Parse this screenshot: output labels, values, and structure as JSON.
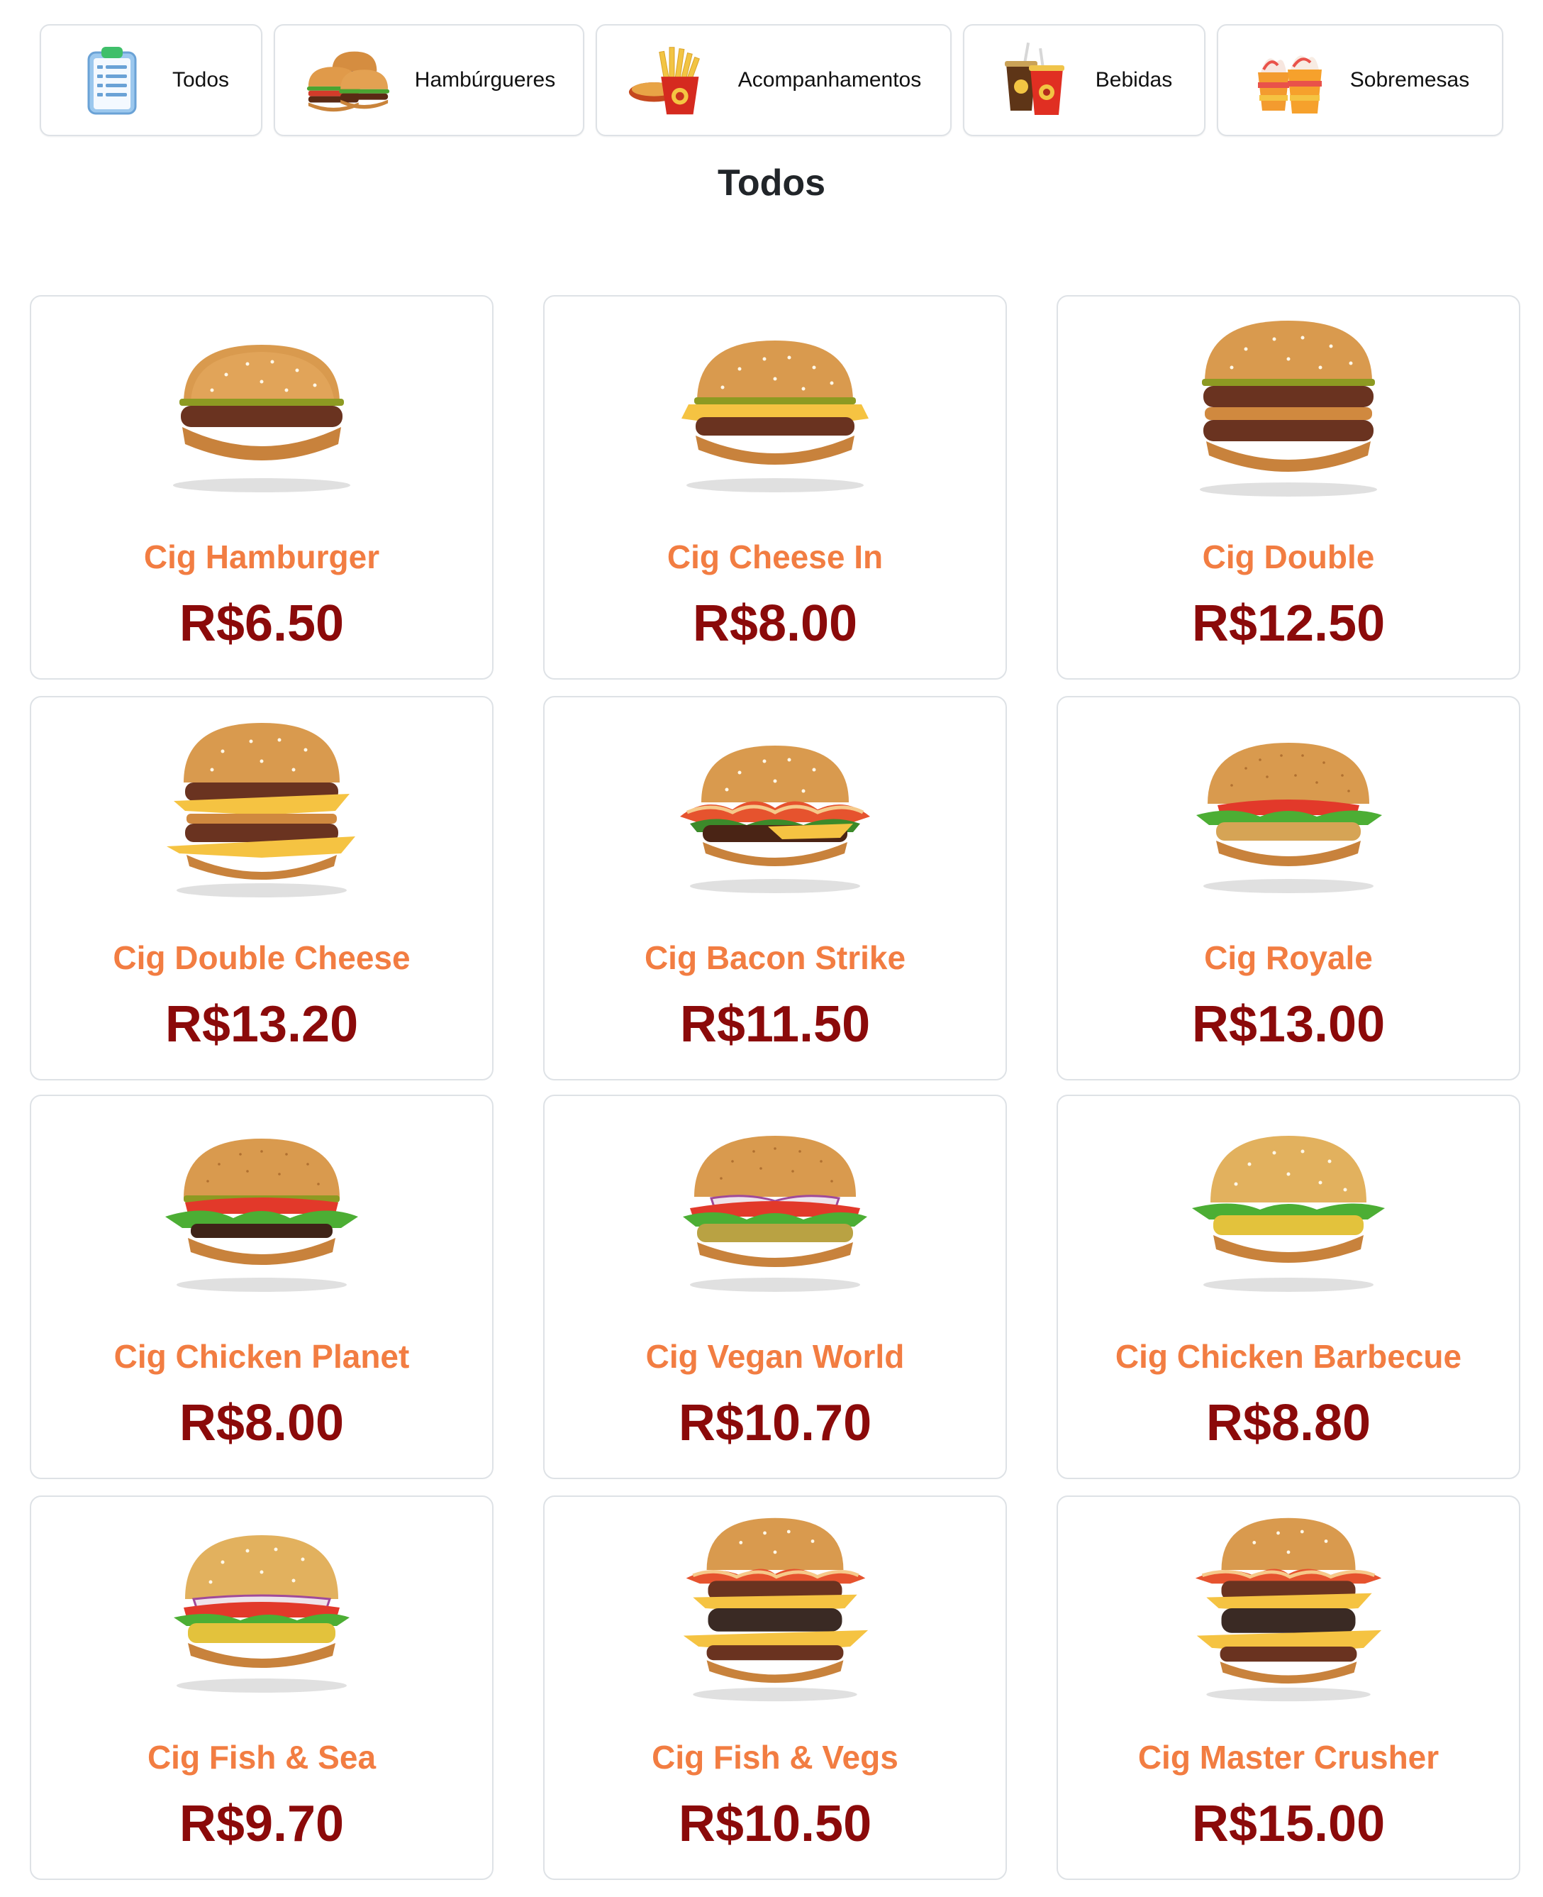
{
  "categories": [
    {
      "label": "Todos",
      "icon": "clipboard-list-icon"
    },
    {
      "label": "Hambúrgueres",
      "icon": "burgers-icon"
    },
    {
      "label": "Acompanhamentos",
      "icon": "fries-icon"
    },
    {
      "label": "Bebidas",
      "icon": "drinks-icon"
    },
    {
      "label": "Sobremesas",
      "icon": "sundae-icon"
    }
  ],
  "section_title": "Todos",
  "colors": {
    "name": "#f27d42",
    "price": "#8b0a0a",
    "border": "#dee2e6"
  },
  "products": [
    {
      "name": "Cig Hamburger",
      "price": "R$6.50",
      "icon": "hamburger-icon"
    },
    {
      "name": "Cig Cheese In",
      "price": "R$8.00",
      "icon": "cheeseburger-icon"
    },
    {
      "name": "Cig Double",
      "price": "R$12.50",
      "icon": "double-burger-icon"
    },
    {
      "name": "Cig Double Cheese",
      "price": "R$13.20",
      "icon": "double-cheeseburger-icon"
    },
    {
      "name": "Cig Bacon Strike",
      "price": "R$11.50",
      "icon": "bacon-burger-icon"
    },
    {
      "name": "Cig Royale",
      "price": "R$13.00",
      "icon": "royale-burger-icon"
    },
    {
      "name": "Cig Chicken Planet",
      "price": "R$8.00",
      "icon": "chicken-burger-icon"
    },
    {
      "name": "Cig Vegan World",
      "price": "R$10.70",
      "icon": "vegan-burger-icon"
    },
    {
      "name": "Cig Chicken Barbecue",
      "price": "R$8.80",
      "icon": "chicken-bbq-burger-icon"
    },
    {
      "name": "Cig Fish & Sea",
      "price": "R$9.70",
      "icon": "fish-burger-icon"
    },
    {
      "name": "Cig Fish & Vegs",
      "price": "R$10.50",
      "icon": "fish-vegs-burger-icon"
    },
    {
      "name": "Cig Master Crusher",
      "price": "R$15.00",
      "icon": "master-burger-icon"
    }
  ]
}
